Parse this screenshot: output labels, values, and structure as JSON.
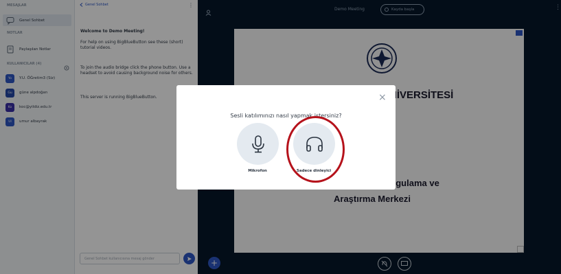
{
  "userlist": {
    "messages_title": "MESAJLAR",
    "public_chat": "Genel Sohbet",
    "notes_title": "NOTLAR",
    "shared_notes": "Paylaşılan Notlar",
    "users_title": "KULLANICILAR (4)",
    "users": [
      {
        "initials": "Yo",
        "name": "Y.U. ÖĞretim3 (Siz)"
      },
      {
        "initials": "Gu",
        "name": "güne alpdoğan"
      },
      {
        "initials": "Ko",
        "name": "koc@yildiz.edu.tr"
      },
      {
        "initials": "Ul",
        "name": "umur albayrak"
      }
    ]
  },
  "chat": {
    "back_label": "Genel Sohbet",
    "messages": [
      "Welcome to Demo Meeting!",
      "For help on using BigBlueButton see these (short) tutorial videos.",
      "To join the audio bridge click the phone button. Use a headset to avoid causing background noise for others.",
      "This server is running BigBlueButton."
    ],
    "input_placeholder": "Genel Sohbet kullanıcısına mesaj gönder"
  },
  "header": {
    "meeting_title": "Demo Meeting",
    "record_label": "Kayda başla"
  },
  "slide": {
    "title_fragment": "NİVERSİTESİ",
    "line1_fragment": "ygulama ve",
    "line2": "Araştırma Merkezi"
  },
  "modal": {
    "question": "Sesli katılımınızı nasıl yapmak istersiniz?",
    "close_symbol": "×",
    "mic_label": "Mikrofon",
    "listen_label": "Sadece dinleyici"
  },
  "colors": {
    "accent": "#2d57c5",
    "highlight": "#b5121b",
    "background": "#06172a"
  }
}
